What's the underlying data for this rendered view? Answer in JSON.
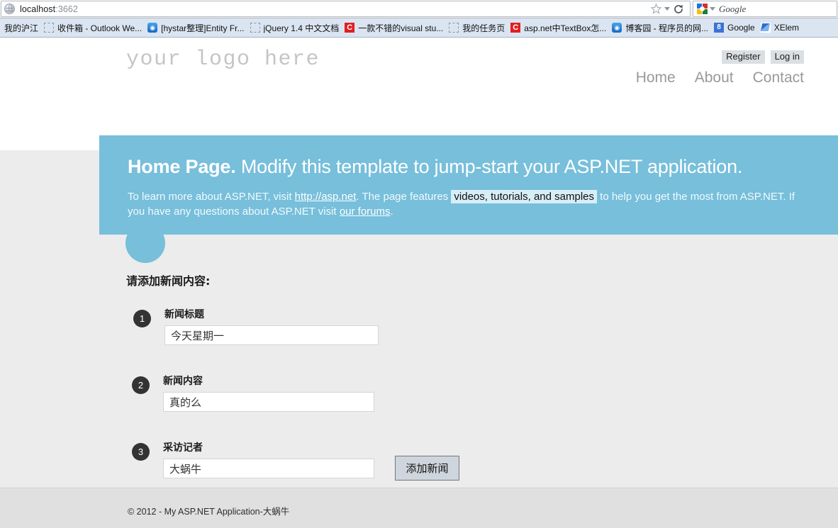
{
  "browser": {
    "url_host": "localhost",
    "url_port": ":3662",
    "favicon": "globe-icon",
    "star": "bookmark-star-icon",
    "caret": "dropdown-caret-icon",
    "reload": "reload-icon",
    "search_engine_label": "Google",
    "bookmarks": [
      {
        "label": "我的沪江",
        "icon": "none"
      },
      {
        "label": "收件箱 - Outlook We...",
        "icon": "placeholder"
      },
      {
        "label": "[hystar整理]Entity Fr...",
        "icon": "blue-circle",
        "glyph": "◉"
      },
      {
        "label": "jQuery 1.4 中文文档",
        "icon": "placeholder"
      },
      {
        "label": "一款不错的visual stu...",
        "icon": "red-c",
        "glyph": "C"
      },
      {
        "label": "我的任务页",
        "icon": "placeholder"
      },
      {
        "label": "asp.net中TextBox怎...",
        "icon": "red-c",
        "glyph": "C"
      },
      {
        "label": "博客园 - 程序员的网...",
        "icon": "blue-circle",
        "glyph": "◉"
      },
      {
        "label": "Google",
        "icon": "g8",
        "glyph": "8"
      },
      {
        "label": "XElem",
        "icon": "xel"
      }
    ]
  },
  "site": {
    "logo_text": "your logo here",
    "auth_links": [
      {
        "label": "Register"
      },
      {
        "label": "Log in"
      }
    ],
    "nav": [
      {
        "label": "Home"
      },
      {
        "label": "About"
      },
      {
        "label": "Contact"
      }
    ]
  },
  "banner": {
    "heading_strong": "Home Page.",
    "heading_rest": " Modify this template to jump-start your ASP.NET application.",
    "body_part1": "To learn more about ASP.NET, visit ",
    "link_aspnet": "http://asp.net",
    "body_part2": ". The page features ",
    "link_videos": "videos, tutorials, and samples",
    "body_part3": " to help you get the most from ASP.NET. If you have any questions about ASP.NET visit ",
    "link_forums": "our forums",
    "body_part4": ".",
    "accent_color": "#77bfdb"
  },
  "form": {
    "title": "请添加新闻内容:",
    "steps": [
      {
        "number": "1",
        "label": "新闻标题",
        "value": "今天星期一"
      },
      {
        "number": "2",
        "label": "新闻内容",
        "value": "真的么"
      },
      {
        "number": "3",
        "label": "采访记者",
        "value": "大蜗牛"
      }
    ],
    "submit_label": "添加新闻"
  },
  "footer": {
    "copyright": "© 2012 - My ASP.NET Application-大蜗牛"
  }
}
